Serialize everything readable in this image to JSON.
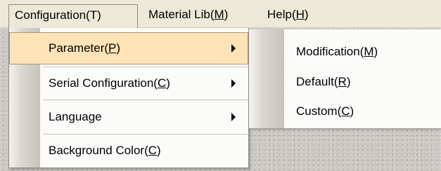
{
  "menubar": {
    "items": [
      {
        "label": "Configuration(T)"
      },
      {
        "pre": "Material Lib(",
        "accel": "M",
        "post": ")"
      },
      {
        "pre": "Help(",
        "accel": "H",
        "post": ")"
      }
    ]
  },
  "main_menu": {
    "items": [
      {
        "pre": "Parameter(",
        "accel": "P",
        "post": ")",
        "submenu": true
      },
      {
        "pre": "Serial Configuration(",
        "accel": "C",
        "post": ")",
        "submenu": true
      },
      {
        "pre": "Language",
        "accel": "",
        "post": "",
        "submenu": true
      },
      {
        "pre": "Background Color(",
        "accel": "C",
        "post": ")",
        "submenu": false
      }
    ]
  },
  "sub_menu": {
    "items": [
      {
        "pre": "Modification(",
        "accel": "M",
        "post": ")"
      },
      {
        "pre": "Default(",
        "accel": "R",
        "post": ")"
      },
      {
        "pre": "Custom(",
        "accel": "C",
        "post": ")"
      }
    ]
  },
  "colors": {
    "menubar_bg": "#ece9d8",
    "highlight_bg": "#fde3b6",
    "menu_bg": "#fbfbf9"
  }
}
